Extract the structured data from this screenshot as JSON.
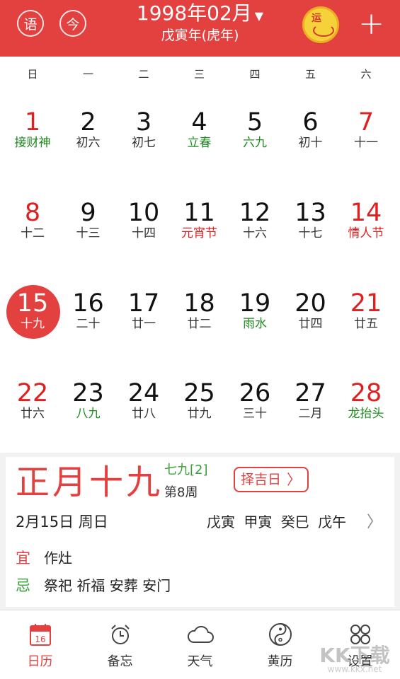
{
  "header": {
    "lang_button": "语",
    "today_button": "今",
    "title": "1998年02月",
    "caret": "▼",
    "subtitle": "戊寅年(虎年)",
    "fortune_badge": "运",
    "add_button": "+"
  },
  "weekdays": [
    "日",
    "一",
    "二",
    "三",
    "四",
    "五",
    "六"
  ],
  "calendar": {
    "rows": [
      [
        {
          "day": "1",
          "lunar": "接财神",
          "day_color": "red",
          "lunar_color": "green"
        },
        {
          "day": "2",
          "lunar": "初六",
          "day_color": "black",
          "lunar_color": "black"
        },
        {
          "day": "3",
          "lunar": "初七",
          "day_color": "black",
          "lunar_color": "black"
        },
        {
          "day": "4",
          "lunar": "立春",
          "day_color": "black",
          "lunar_color": "green"
        },
        {
          "day": "5",
          "lunar": "六九",
          "day_color": "black",
          "lunar_color": "green"
        },
        {
          "day": "6",
          "lunar": "初十",
          "day_color": "black",
          "lunar_color": "black"
        },
        {
          "day": "7",
          "lunar": "十一",
          "day_color": "red",
          "lunar_color": "black"
        }
      ],
      [
        {
          "day": "8",
          "lunar": "十二",
          "day_color": "red",
          "lunar_color": "black"
        },
        {
          "day": "9",
          "lunar": "十三",
          "day_color": "black",
          "lunar_color": "black"
        },
        {
          "day": "10",
          "lunar": "十四",
          "day_color": "black",
          "lunar_color": "black"
        },
        {
          "day": "11",
          "lunar": "元宵节",
          "day_color": "black",
          "lunar_color": "red"
        },
        {
          "day": "12",
          "lunar": "十六",
          "day_color": "black",
          "lunar_color": "black"
        },
        {
          "day": "13",
          "lunar": "十七",
          "day_color": "black",
          "lunar_color": "black"
        },
        {
          "day": "14",
          "lunar": "情人节",
          "day_color": "red",
          "lunar_color": "red"
        }
      ],
      [
        {
          "day": "15",
          "lunar": "十九",
          "day_color": "white",
          "lunar_color": "white",
          "selected": true
        },
        {
          "day": "16",
          "lunar": "二十",
          "day_color": "black",
          "lunar_color": "black"
        },
        {
          "day": "17",
          "lunar": "廿一",
          "day_color": "black",
          "lunar_color": "black"
        },
        {
          "day": "18",
          "lunar": "廿二",
          "day_color": "black",
          "lunar_color": "black"
        },
        {
          "day": "19",
          "lunar": "雨水",
          "day_color": "black",
          "lunar_color": "green"
        },
        {
          "day": "20",
          "lunar": "廿四",
          "day_color": "black",
          "lunar_color": "black"
        },
        {
          "day": "21",
          "lunar": "廿五",
          "day_color": "red",
          "lunar_color": "black"
        }
      ],
      [
        {
          "day": "22",
          "lunar": "廿六",
          "day_color": "red",
          "lunar_color": "black"
        },
        {
          "day": "23",
          "lunar": "八九",
          "day_color": "black",
          "lunar_color": "green"
        },
        {
          "day": "24",
          "lunar": "廿八",
          "day_color": "black",
          "lunar_color": "black"
        },
        {
          "day": "25",
          "lunar": "廿九",
          "day_color": "black",
          "lunar_color": "black"
        },
        {
          "day": "26",
          "lunar": "三十",
          "day_color": "black",
          "lunar_color": "black"
        },
        {
          "day": "27",
          "lunar": "二月",
          "day_color": "black",
          "lunar_color": "black"
        },
        {
          "day": "28",
          "lunar": "龙抬头",
          "day_color": "red",
          "lunar_color": "green"
        }
      ]
    ]
  },
  "detail": {
    "lunar_date": "正月十九",
    "jiu": "七九[2]",
    "week": "第8周",
    "auspicious_button": "择吉日",
    "auspicious_arrow": "〉",
    "date_line": "2月15日 周日",
    "ganzhi": "戊寅 甲寅 癸巳 戊午",
    "ganzhi_arrow": "〉",
    "yi_label": "宜",
    "yi_text": "作灶",
    "ji_label": "忌",
    "ji_text": "祭祀 祈福 安葬 安门"
  },
  "tabs": [
    {
      "label": "日历",
      "icon": "calendar-icon",
      "active": true,
      "icon_text": "16"
    },
    {
      "label": "备忘",
      "icon": "alarm-clock-icon",
      "active": false
    },
    {
      "label": "天气",
      "icon": "cloud-icon",
      "active": false
    },
    {
      "label": "黄历",
      "icon": "yin-yang-icon",
      "active": false
    },
    {
      "label": "设置",
      "icon": "grid-circles-icon",
      "active": false
    }
  ],
  "watermark": {
    "text": "KK下载",
    "sub": "www.kkx.net"
  },
  "colors": {
    "accent": "#e34040",
    "red": "#e02020",
    "green": "#1f8a1f",
    "yi": "#e34040",
    "ji": "#3aa03a"
  }
}
